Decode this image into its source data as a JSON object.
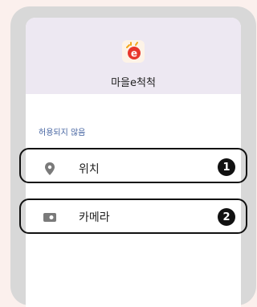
{
  "app": {
    "name": "마을e척척",
    "logo_icon": "app-logo-icon"
  },
  "section": {
    "title": "허용되지 않음"
  },
  "permissions": [
    {
      "label": "위치",
      "icon": "location-pin-icon",
      "badge": "1"
    },
    {
      "label": "카메라",
      "icon": "camera-icon",
      "badge": "2"
    }
  ],
  "colors": {
    "page_background": "#fbf0ed",
    "frame": "#d8d8d8",
    "header_background": "#ede8f2",
    "section_title": "#3f5f9e",
    "callout_border": "#111111",
    "icon": "#7a7a7a"
  }
}
